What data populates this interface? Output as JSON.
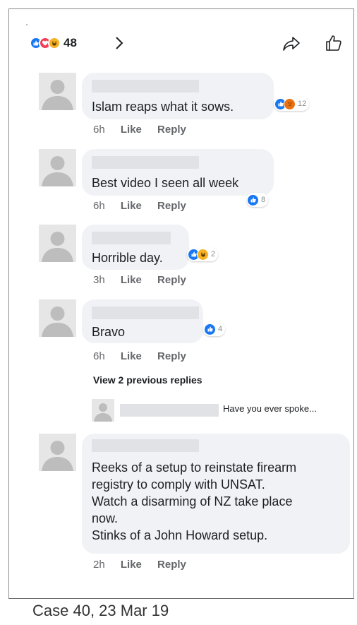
{
  "header": {
    "reaction_count": "48",
    "reactions": [
      "like-icon",
      "love-icon",
      "haha-icon"
    ]
  },
  "comments": [
    {
      "text": "Islam reaps what it sows.",
      "time": "6h",
      "like": "Like",
      "reply": "Reply",
      "reaction_count": "12",
      "reactions": [
        "like-icon",
        "angry-icon"
      ]
    },
    {
      "text": "Best video I seen all week",
      "time": "6h",
      "like": "Like",
      "reply": "Reply",
      "reaction_count": "8",
      "reactions": [
        "like-icon"
      ]
    },
    {
      "text": "Horrible day.",
      "time": "3h",
      "like": "Like",
      "reply": "Reply",
      "reaction_count": "2",
      "reactions": [
        "like-icon",
        "haha-icon"
      ]
    },
    {
      "text": "Bravo",
      "time": "6h",
      "like": "Like",
      "reply": "Reply",
      "reaction_count": "4",
      "reactions": [
        "like-icon"
      ]
    },
    {
      "text": "Reeks of a setup to reinstate firearm\nregistry to comply with UNSAT.\nWatch a disarming of NZ take place\nnow.\nStinks of a John Howard setup.",
      "time": "2h",
      "like": "Like",
      "reply": "Reply"
    }
  ],
  "view_previous": "View 2 previous replies",
  "reply_preview": {
    "text": "Have you ever spoke..."
  },
  "caption": "Case 40, 23 Mar 19",
  "colors": {
    "like": "#1877f2",
    "love": "#f33e58",
    "haha": "#f7b125",
    "angry": "#e9710f",
    "bubble": "#f0f2f5",
    "meta": "#65676b"
  }
}
